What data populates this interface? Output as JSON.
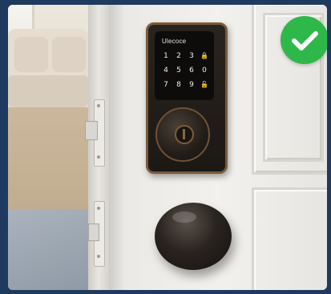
{
  "scene": {
    "lock_brand": "Ulecoce",
    "keypad_keys": [
      "1",
      "2",
      "3",
      "🔒",
      "4",
      "5",
      "6",
      "0",
      "7",
      "8",
      "9",
      "🔓"
    ],
    "badge_icon": "checkmark-icon",
    "colors": {
      "frame": "#1e3a5f",
      "badge": "#2fb84a",
      "lock_trim": "#7a5a3a",
      "lock_body": "#1c1814"
    }
  }
}
